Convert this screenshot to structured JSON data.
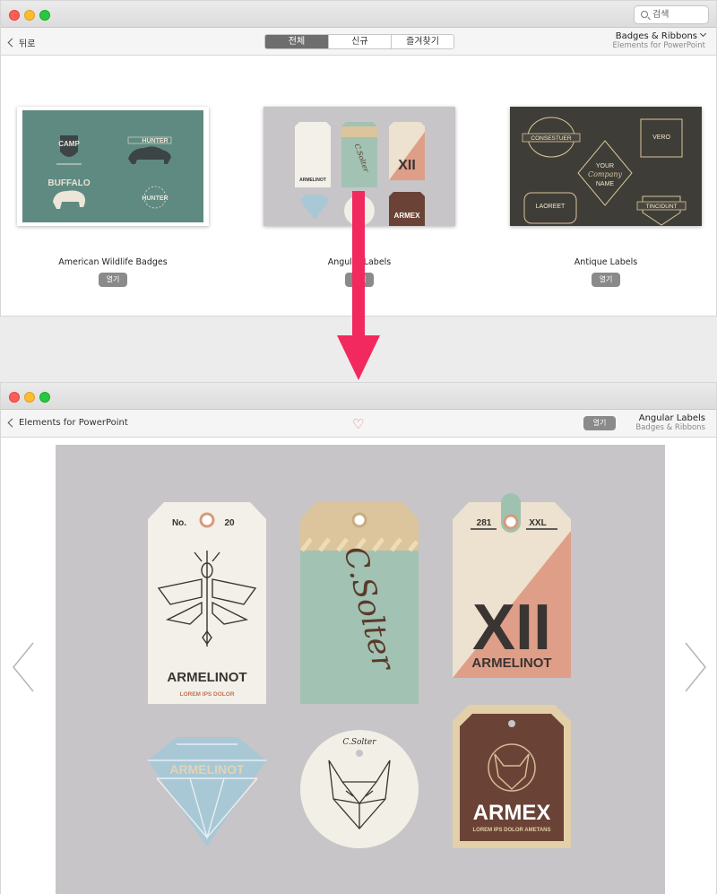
{
  "top_window": {
    "search": {
      "label": "검색"
    },
    "toolbar": {
      "back_label": "뒤로",
      "tabs": [
        "전체",
        "신규",
        "즐겨찾기"
      ],
      "active_tab": "전체",
      "breadcrumb_title": "Badges & Ribbons",
      "breadcrumb_subtitle": "Elements for PowerPoint"
    },
    "cards": [
      {
        "name": "American Wildlife Badges",
        "button": "열기",
        "badges": {
          "camp": "CAMP",
          "hunter": "HUNTER",
          "buffalo": "BUFFALO",
          "hunter2": "HUNTER"
        }
      },
      {
        "name": "Angular Labels",
        "button": "열기",
        "badges": {
          "armelinot": "ARMELINOT",
          "solter": "C.Solter",
          "xii": "XII",
          "armex": "ARMEX"
        }
      },
      {
        "name": "Antique Labels",
        "button": "열기",
        "badges": {
          "consestuer": "CONSESTUER",
          "vero": "VERO",
          "your": "YOUR",
          "company": "Company",
          "name": "NAME",
          "laoreet": "LAOREET",
          "tincidunt": "TINCIDUNT"
        }
      }
    ]
  },
  "bottom_window": {
    "toolbar": {
      "back_label": "Elements for PowerPoint",
      "open_button": "열기",
      "title": "Angular Labels",
      "subtitle": "Badges & Ribbons"
    },
    "labels": {
      "tag1_no": "No.",
      "tag1_num": "20",
      "tag1_title": "ARMELINOT",
      "tag1_sub": "LOREM IPS DOLOR",
      "tag2_script": "C.Solter",
      "tag3_num": "281",
      "tag3_size": "XXL",
      "tag3_roman": "XII",
      "tag3_title": "ARMELINOT",
      "tag4_title": "ARMELINOT",
      "tag5_script": "C.Solter",
      "tag6_title": "ARMEX",
      "tag6_sub": "LOREM IPS DOLOR AMETANS"
    }
  },
  "colors": {
    "accent_arrow": "#f1295e",
    "segment_active": "#6e6e6e",
    "stage_bg": "#c7c5c8",
    "heart": "#e07a7a"
  }
}
